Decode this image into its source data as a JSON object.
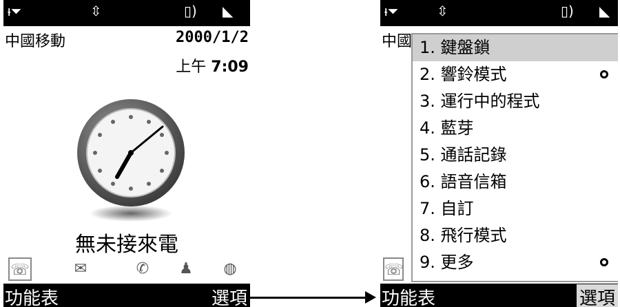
{
  "left_screen": {
    "carrier": "中國移動",
    "date": "2000/1/2",
    "time_period": "上午",
    "time": "7:09",
    "missed_calls": "無未接來電",
    "shortcuts": [
      "calls-icon",
      "messages-icon",
      "mail-icon",
      "contacts-icon",
      "browser-icon"
    ],
    "softkey_left": "功能表",
    "softkey_right": "選項"
  },
  "right_screen": {
    "carrier_partial": "中國",
    "menu_items": [
      {
        "label": "1. 鍵盤鎖",
        "selected": true,
        "indicator": false
      },
      {
        "label": "2. 響鈴模式",
        "selected": false,
        "indicator": true
      },
      {
        "label": "3. 運行中的程式",
        "selected": false,
        "indicator": false
      },
      {
        "label": "4. 藍芽",
        "selected": false,
        "indicator": false
      },
      {
        "label": "5. 通話記錄",
        "selected": false,
        "indicator": false
      },
      {
        "label": "6. 語音信箱",
        "selected": false,
        "indicator": false
      },
      {
        "label": "7. 自訂",
        "selected": false,
        "indicator": false
      },
      {
        "label": "8. 飛行模式",
        "selected": false,
        "indicator": false
      },
      {
        "label": "9. 更多",
        "selected": false,
        "indicator": true
      }
    ],
    "softkey_left": "功能表",
    "softkey_right": "選項"
  },
  "colors": {
    "statusbar": "#000000",
    "highlight": "#cfcfcf",
    "clock_rim": "#6e6e6e"
  }
}
